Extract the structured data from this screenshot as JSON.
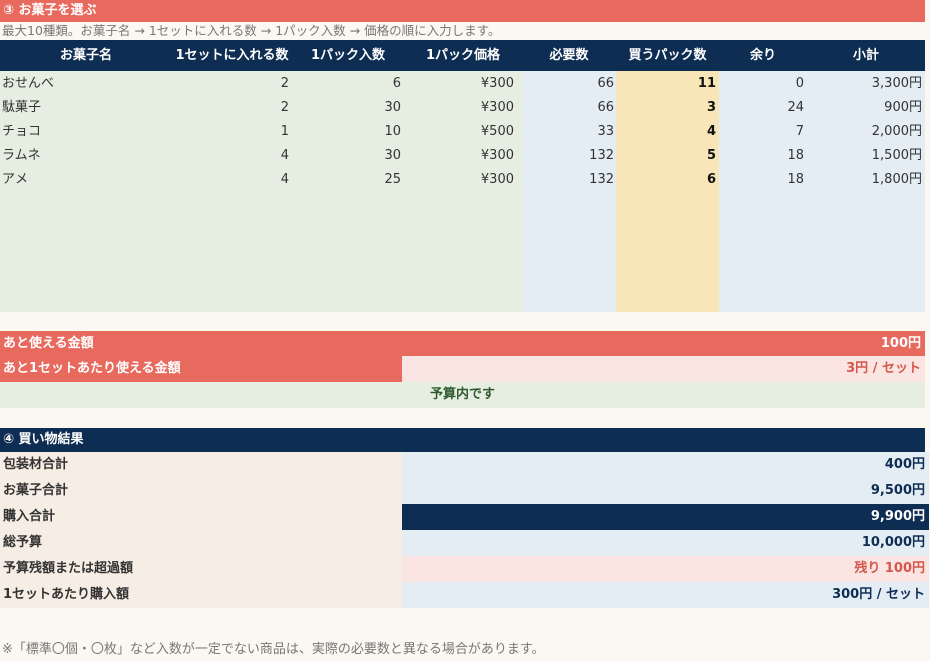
{
  "section3": {
    "title": "③ お菓子を選ぶ",
    "note": "最大10種類。お菓子名 → 1セットに入れる数 → 1パック入数 → 価格の順に入力します。",
    "columns": [
      "お菓子名",
      "1セットに入れる数",
      "1パック入数",
      "1パック価格",
      "必要数",
      "買うパック数",
      "余り",
      "小計"
    ],
    "rows": [
      [
        "おせんべ",
        "2",
        "6",
        "¥300",
        "66",
        "11",
        "0",
        "3,300円"
      ],
      [
        "駄菓子",
        "2",
        "30",
        "¥300",
        "66",
        "3",
        "24",
        "900円"
      ],
      [
        "チョコ",
        "1",
        "10",
        "¥500",
        "33",
        "4",
        "7",
        "2,000円"
      ],
      [
        "ラムネ",
        "4",
        "30",
        "¥300",
        "132",
        "5",
        "18",
        "1,500円"
      ],
      [
        "アメ",
        "4",
        "25",
        "¥300",
        "132",
        "6",
        "18",
        "1,800円"
      ]
    ]
  },
  "budget": {
    "remaining_label": "あと使える金額",
    "remaining_value": "100円",
    "per_set_label": "あと1セットあたり使える金額",
    "per_set_value": "3円 / セット",
    "status": "予算内です"
  },
  "section4": {
    "title": "④ 買い物結果",
    "items": [
      {
        "label": "包装材合計",
        "value": "400円"
      },
      {
        "label": "お菓子合計",
        "value": "9,500円"
      },
      {
        "label": "購入合計",
        "value": "9,900円"
      },
      {
        "label": "総予算",
        "value": "10,000円"
      },
      {
        "label": "予算残額または超過額",
        "value": "残り 100円"
      },
      {
        "label": "1セットあたり購入額",
        "value": "300円 / セット"
      }
    ]
  },
  "footnote": "※「標準〇個・〇枚」など入数が一定でない商品は、実際の必要数と異なる場合があります。",
  "colors": {
    "coral": "#e8695d",
    "navy": "#0e2d52",
    "green_band": "#e6eee2",
    "blue_band": "#e4edf4",
    "yellow_band": "#f8e6b9",
    "pink_band": "#fbe5e3",
    "beige_band": "#f6eee4"
  }
}
